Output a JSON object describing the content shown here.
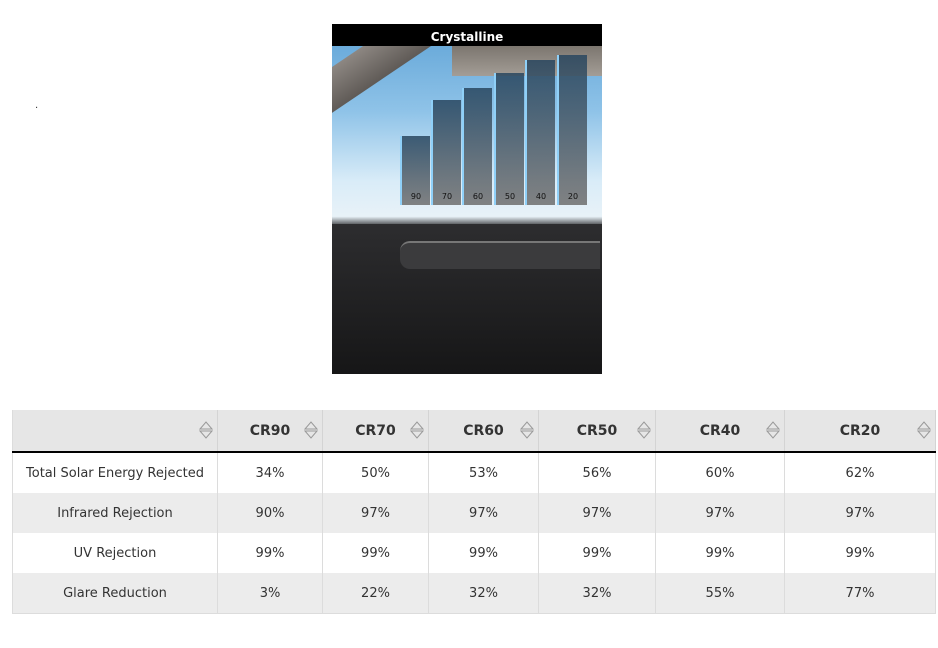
{
  "page": {
    "dot": "."
  },
  "image": {
    "title": "Crystalline",
    "shade_labels": [
      "90",
      "70",
      "60",
      "50",
      "40",
      "20"
    ]
  },
  "table": {
    "columns": [
      "",
      "CR90",
      "CR70",
      "CR60",
      "CR50",
      "CR40",
      "CR20"
    ],
    "rows": [
      {
        "label": "Total Solar Energy Rejected",
        "values": [
          "34%",
          "50%",
          "53%",
          "56%",
          "60%",
          "62%"
        ]
      },
      {
        "label": "Infrared Rejection",
        "values": [
          "90%",
          "97%",
          "97%",
          "97%",
          "97%",
          "97%"
        ]
      },
      {
        "label": "UV Rejection",
        "values": [
          "99%",
          "99%",
          "99%",
          "99%",
          "99%",
          "99%"
        ]
      },
      {
        "label": "Glare Reduction",
        "values": [
          "3%",
          "22%",
          "32%",
          "32%",
          "55%",
          "77%"
        ]
      }
    ]
  }
}
